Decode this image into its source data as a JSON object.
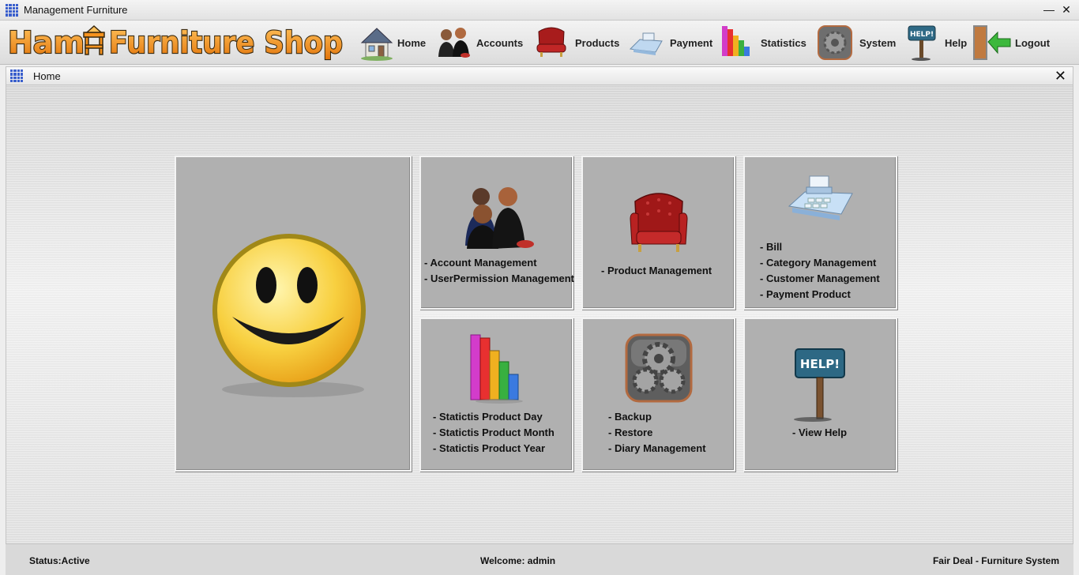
{
  "window": {
    "title": "Management Furniture"
  },
  "brand": {
    "logo_text": "Ham Furniture Shop"
  },
  "nav": [
    {
      "label": "Home",
      "icon": "house-icon"
    },
    {
      "label": "Accounts",
      "icon": "people-icon"
    },
    {
      "label": "Products",
      "icon": "armchair-icon"
    },
    {
      "label": "Payment",
      "icon": "cash-register-icon"
    },
    {
      "label": "Statistics",
      "icon": "bar-chart-icon"
    },
    {
      "label": "System",
      "icon": "gear-icon"
    },
    {
      "label": "Help",
      "icon": "help-sign-icon"
    },
    {
      "label": "Logout",
      "icon": "exit-door-icon"
    }
  ],
  "frame": {
    "title": "Home"
  },
  "tiles": {
    "welcome": {
      "icon": "smiley-icon"
    },
    "accounts": {
      "icon": "people-icon",
      "items": [
        "- Account Management",
        "- UserPermission Management"
      ]
    },
    "products": {
      "icon": "armchair-icon",
      "items": [
        "- Product Management"
      ]
    },
    "payment": {
      "icon": "cash-register-icon",
      "items": [
        "- Bill",
        "- Category Management",
        "- Customer Management",
        "- Payment Product"
      ]
    },
    "statistics": {
      "icon": "bar-chart-icon",
      "items": [
        "- Statictis Product Day",
        "- Statictis Product Month",
        "- Statictis Product Year"
      ]
    },
    "system": {
      "icon": "gear-icon",
      "items": [
        "- Backup",
        "- Restore",
        "- Diary Management"
      ]
    },
    "help": {
      "icon": "help-sign-icon",
      "sign_text": "HELP!",
      "items": [
        "- View Help"
      ]
    }
  },
  "status": {
    "left": "Status:Active",
    "center": "Welcome: admin",
    "right": "Fair Deal - Furniture System"
  },
  "colors": {
    "logo_orange": "#f7931e",
    "logo_outline": "#3a2a10",
    "tile_bg": "#b0b0b0",
    "app_icon_blue": "#3a5fcd"
  }
}
